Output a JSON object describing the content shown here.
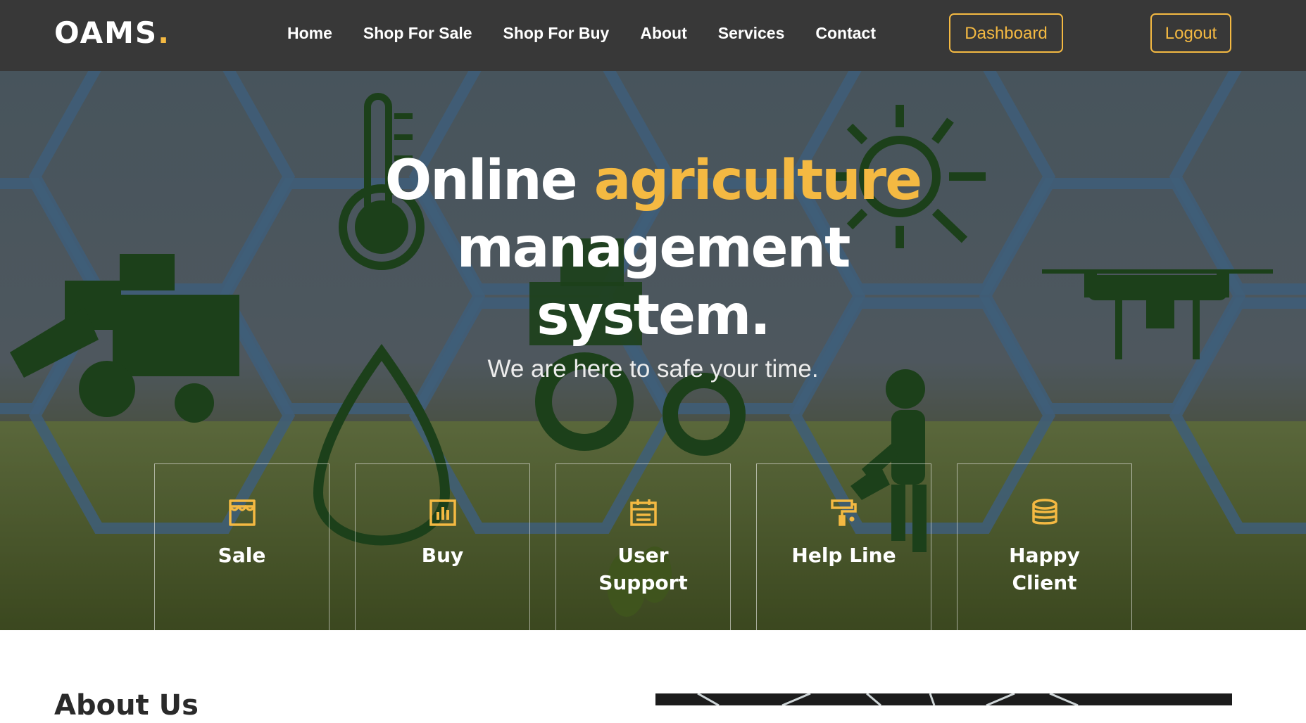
{
  "header": {
    "logo": "OAMS",
    "logo_dot": ".",
    "nav": [
      "Home",
      "Shop For Sale",
      "Shop For Buy",
      "About",
      "Services",
      "Contact"
    ],
    "dashboard_label": "Dashboard",
    "logout_label": "Logout"
  },
  "hero": {
    "title_part1": "Online ",
    "title_accent": "agriculture",
    "title_line2": "management",
    "title_line3": "system.",
    "subtitle": "We are here to safe your time."
  },
  "features": [
    {
      "label": "Sale",
      "icon": "store-icon"
    },
    {
      "label": "Buy",
      "icon": "bar-chart-icon"
    },
    {
      "label": "User Support",
      "icon": "calendar-icon"
    },
    {
      "label": "Help Line",
      "icon": "paint-roller-icon"
    },
    {
      "label": "Happy Client",
      "icon": "database-icon"
    }
  ],
  "about": {
    "heading": "About Us"
  },
  "colors": {
    "accent": "#f4b942",
    "header_bg": "#383838",
    "silhouette": "#1f4f1c",
    "hex_lines": "#4f79a0"
  }
}
